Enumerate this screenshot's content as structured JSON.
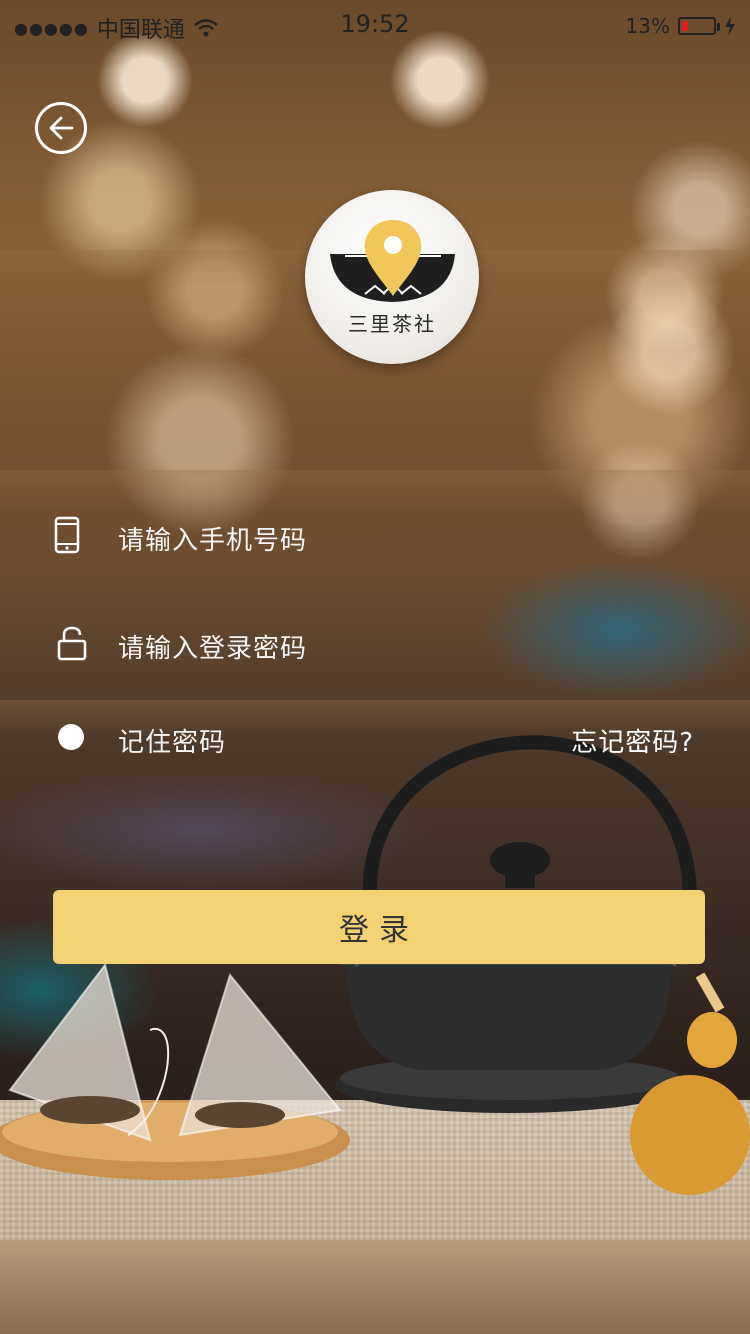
{
  "status_bar": {
    "signal_dots": "●●●●●",
    "carrier": "中国联通",
    "wifi_icon": "wifi-icon",
    "time": "19:52",
    "battery_percent": "13%",
    "battery_level": 0.13,
    "charging_icon": "bolt-icon"
  },
  "header": {
    "back_icon": "arrow-left-icon"
  },
  "logo": {
    "text": "三里茶社"
  },
  "form": {
    "phone_placeholder": "请输入手机号码",
    "phone_icon": "phone-icon",
    "password_placeholder": "请输入登录密码",
    "password_icon": "lock-icon",
    "remember_label": "记住密码",
    "forgot_label": "忘记密码?"
  },
  "login_button": {
    "label": "登录"
  },
  "colors": {
    "button_bg": "#f2d273",
    "logo_pin": "#f1c75c"
  }
}
